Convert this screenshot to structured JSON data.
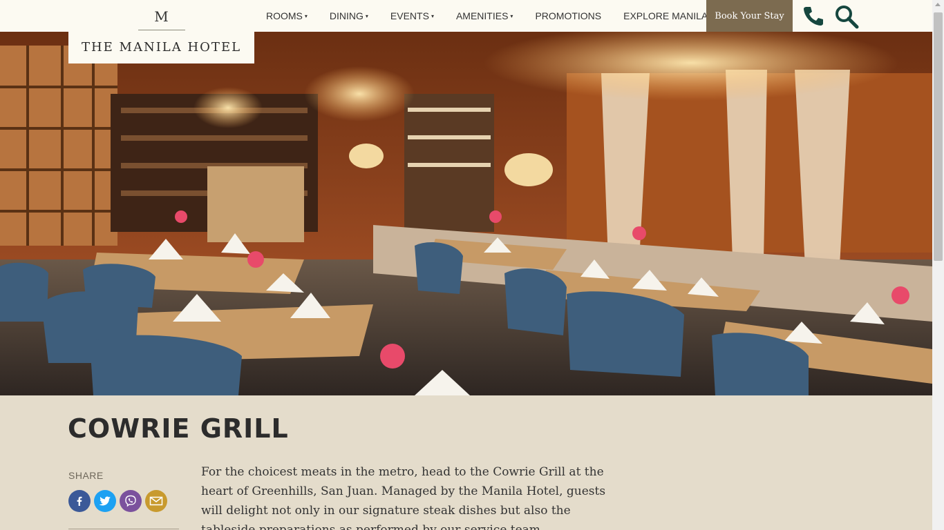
{
  "brand": {
    "monogram": "M",
    "name": "THE MANILA HOTEL"
  },
  "nav": {
    "items": [
      {
        "label": "ROOMS",
        "caret": true
      },
      {
        "label": "DINING",
        "caret": true
      },
      {
        "label": "EVENTS",
        "caret": true
      },
      {
        "label": "AMENITIES",
        "caret": true
      },
      {
        "label": "PROMOTIONS",
        "caret": false
      },
      {
        "label": "EXPLORE MANILA",
        "caret": false
      }
    ],
    "caret_glyph": "▾",
    "book_label": "Book Your Stay"
  },
  "icons": {
    "phone": "phone-icon",
    "search": "search-icon",
    "accent": "#16473f"
  },
  "hero": {
    "subject": "restaurant-interior-photo"
  },
  "page": {
    "title": "COWRIE GRILL",
    "share_label": "SHARE",
    "share_buttons": [
      {
        "name": "facebook",
        "color": "#3b5998"
      },
      {
        "name": "twitter",
        "color": "#1da1f2"
      },
      {
        "name": "viber",
        "color": "#7b519d"
      },
      {
        "name": "email",
        "color": "#c89a2e"
      }
    ],
    "description": "For the choicest meats in the metro, head to the Cowrie Grill at the heart of Greenhills, San Juan. Managed by the Manila Hotel, guests will delight not only in our signature steak dishes but also the tableside preparations as performed by our service team."
  },
  "colors": {
    "header_bg": "#fcfaf2",
    "book_bg": "#7c6b50",
    "content_bg": "#e4dccb"
  }
}
